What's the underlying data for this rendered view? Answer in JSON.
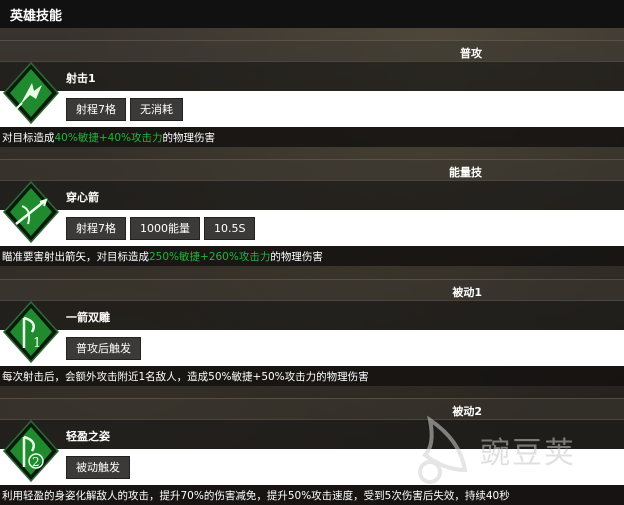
{
  "header": {
    "title": "英雄技能"
  },
  "sections": [
    {
      "category": "普攻",
      "name": "射击1",
      "tags": [
        "射程7格",
        "无消耗"
      ],
      "desc": {
        "pre": "对目标造成",
        "highlight": "40%敏捷+40%攻击力",
        "post": "的物理伤害"
      },
      "icon": "arrow-shot-icon"
    },
    {
      "category": "能量技",
      "name": "穿心箭",
      "tags": [
        "射程7格",
        "1000能量",
        "10.5S"
      ],
      "desc": {
        "pre": "瞄准要害射出箭矢，对目标造成",
        "highlight": "250%敏捷+260%攻击力",
        "post": "的物理伤害"
      },
      "icon": "piercing-arrow-icon"
    },
    {
      "category": "被动1",
      "name": "一箭双雕",
      "tags": [
        "普攻后触发"
      ],
      "desc": {
        "pre": "每次射击后，会额外攻击附近1名敌人，造成50%敏捷+50%攻击力的物理伤害",
        "highlight": "",
        "post": ""
      },
      "icon": "passive-1-icon"
    },
    {
      "category": "被动2",
      "name": "轻盈之姿",
      "tags": [
        "被动触发"
      ],
      "desc": {
        "pre": "利用轻盈的身姿化解敌人的攻击，提升70%的伤害减免，提升50%攻击速度，受到5次伤害后失效，持续40秒",
        "highlight": "",
        "post": ""
      },
      "icon": "passive-2-icon"
    }
  ],
  "watermark": {
    "text": "豌豆荚"
  },
  "colors": {
    "accent_green": "#27b33a",
    "icon_green": "#1f8a2e"
  }
}
